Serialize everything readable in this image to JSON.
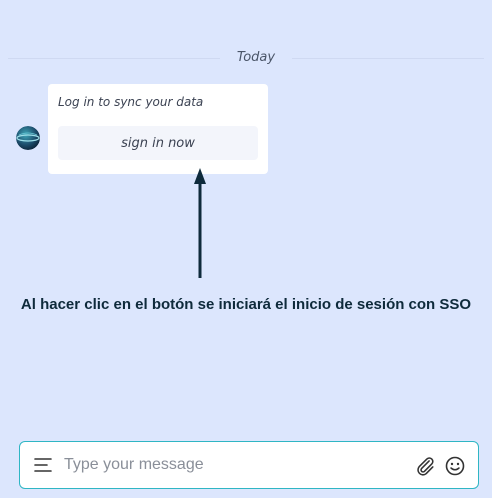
{
  "chat": {
    "date_divider": "Today",
    "message": {
      "prompt": "Log in to sync your data",
      "button_label": "sign in now"
    }
  },
  "annotation": {
    "text": "Al hacer clic en el botón se iniciará el inicio de sesión con SSO"
  },
  "composer": {
    "placeholder": "Type your message",
    "icons": [
      "menu-icon",
      "paperclip-icon",
      "smiley-icon"
    ]
  },
  "colors": {
    "background": "#dce6fd",
    "composer_border": "#2fb6c4",
    "arrow": "#0e2a3b"
  }
}
